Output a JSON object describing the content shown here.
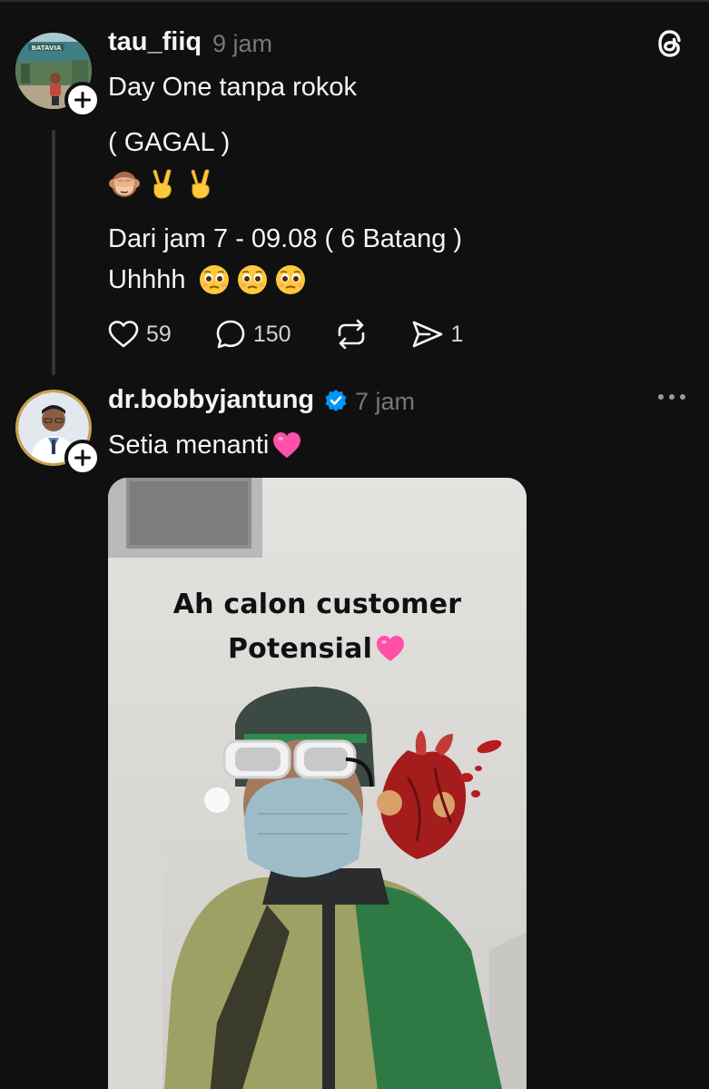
{
  "posts": [
    {
      "username": "tau_fiiq",
      "time": "9 jam",
      "lines": {
        "line1": "Day One tanpa rokok",
        "line2": "( GAGAL )",
        "line3": "Dari jam 7 - 09.08 ( 6 Batang )",
        "line4": "Uhhhh"
      },
      "emoji_lines": {
        "row1": [
          "see-no-evil-monkey",
          "victory-hand",
          "victory-hand"
        ],
        "row2": [
          "pleading-face",
          "pleading-face",
          "pleading-face"
        ]
      },
      "actions": {
        "likes": "59",
        "comments": "150",
        "shares": "1"
      }
    },
    {
      "username": "dr.bobbyjantung",
      "time": "7 jam",
      "verified": true,
      "text": "Setia menanti",
      "text_emoji": "pink-heart",
      "media": {
        "caption_line1": "Ah calon customer",
        "caption_line2": "Potensial",
        "caption_emoji": "pink-heart",
        "sticker": "anatomical-heart"
      }
    }
  ],
  "icons": {
    "app_logo": "threads-logo-icon",
    "more": "more-options-icon",
    "follow": "plus-icon",
    "like": "heart-outline-icon",
    "comment": "comment-bubble-icon",
    "repost": "repost-icon",
    "share": "send-icon",
    "verified": "verified-badge-icon"
  },
  "colors": {
    "background": "#101010",
    "text": "#f3f5f7",
    "muted": "#777777",
    "verified": "#0095f6",
    "pink_heart": "#ff4fa8"
  }
}
